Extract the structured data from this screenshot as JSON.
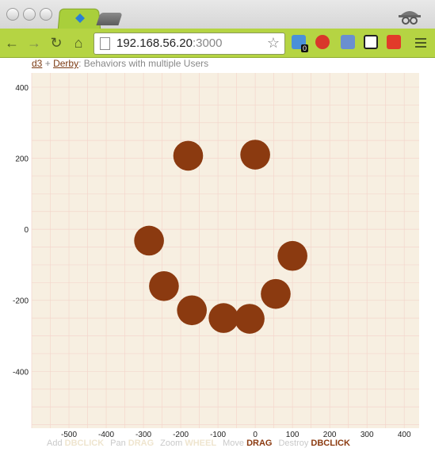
{
  "browser": {
    "url_host": "192.168.56.20",
    "url_port": ":3000",
    "extension_badge": "0"
  },
  "page": {
    "link_d3": "d3",
    "separator": "+",
    "link_derby": "Derby",
    "title_suffix": ": Behaviors with multiple Users"
  },
  "help": [
    {
      "label": "Add",
      "gesture": "DBCLICK",
      "active": false
    },
    {
      "label": "Pan",
      "gesture": "DRAG",
      "active": false
    },
    {
      "label": "Zoom",
      "gesture": "WHEEL",
      "active": false
    },
    {
      "label": "Move",
      "gesture": "DRAG",
      "active": true
    },
    {
      "label": "Destroy",
      "gesture": "DBCLICK",
      "active": true
    }
  ],
  "colors": {
    "plot_bg": "#f7efe1",
    "grid": "#f4d6cc",
    "circle": "#8b3a10",
    "toolbar": "#b5d443"
  },
  "chart_data": {
    "type": "scatter",
    "xlim": [
      -600,
      440
    ],
    "ylim": [
      -560,
      440
    ],
    "x_ticks": [
      -500,
      -400,
      -300,
      -200,
      -100,
      0,
      100,
      200,
      300,
      400
    ],
    "y_ticks": [
      400,
      200,
      0,
      -200,
      -400
    ],
    "grid": true,
    "points": [
      {
        "x": -180,
        "y": 207
      },
      {
        "x": 0,
        "y": 210
      },
      {
        "x": -285,
        "y": -32
      },
      {
        "x": -245,
        "y": -160
      },
      {
        "x": -170,
        "y": -228
      },
      {
        "x": -85,
        "y": -250
      },
      {
        "x": -15,
        "y": -252
      },
      {
        "x": 55,
        "y": -182
      },
      {
        "x": 100,
        "y": -75
      }
    ],
    "radius": 40
  }
}
